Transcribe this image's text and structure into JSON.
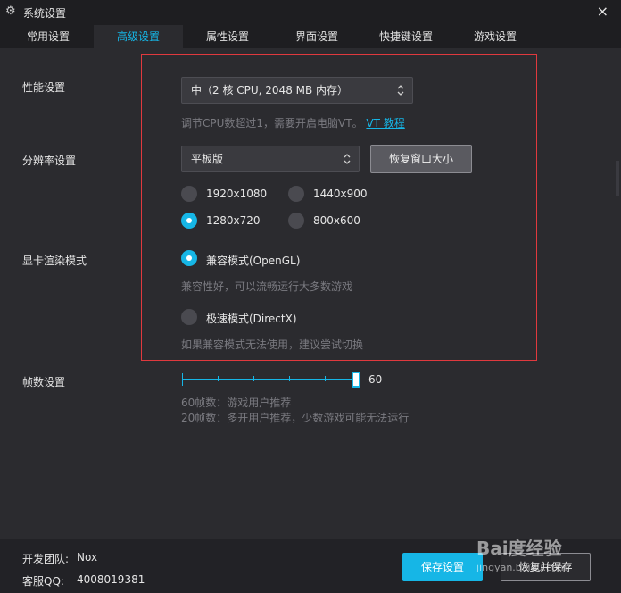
{
  "window": {
    "title": "系统设置",
    "gear_icon": "gear-icon",
    "close_icon": "close-icon",
    "close_glyph": "×"
  },
  "tabs": [
    {
      "label": "常用设置"
    },
    {
      "label": "高级设置",
      "active": true
    },
    {
      "label": "属性设置"
    },
    {
      "label": "界面设置"
    },
    {
      "label": "快捷键设置"
    },
    {
      "label": "游戏设置"
    }
  ],
  "performance": {
    "label": "性能设置",
    "select_value": "中（2 核 CPU, 2048 MB 内存）",
    "hint_prefix": "调节CPU数超过1，需要开启电脑VT。",
    "hint_link": "VT 教程"
  },
  "resolution": {
    "label": "分辨率设置",
    "select_value": "平板版",
    "restore_button": "恢复窗口大小",
    "options": [
      {
        "label": "1920x1080",
        "selected": false
      },
      {
        "label": "1440x900",
        "selected": false
      },
      {
        "label": "1280x720",
        "selected": true
      },
      {
        "label": "800x600",
        "selected": false
      }
    ]
  },
  "render": {
    "label": "显卡渲染模式",
    "option1": "兼容模式(OpenGL)",
    "option1_hint": "兼容性好，可以流畅运行大多数游戏",
    "option2": "极速模式(DirectX)",
    "option2_hint": "如果兼容模式无法使用，建议尝试切换",
    "selected": "option1"
  },
  "fps": {
    "label": "帧数设置",
    "value": "60",
    "hint1": "60帧数：游戏用户推荐",
    "hint2": "20帧数：多开用户推荐，少数游戏可能无法运行"
  },
  "footer": {
    "team_label": "开发团队:",
    "team_value": "Nox",
    "qq_label": "客服QQ:",
    "qq_value": "4008019381",
    "save_button": "保存设置",
    "restore_save_button": "恢复并保存"
  },
  "watermark": {
    "line1": "Bai度经验",
    "line2": "jingyan.baidu.com"
  },
  "colors": {
    "accent": "#16b6e6",
    "highlight_box": "#e0393e",
    "background": "#2b2b2f"
  }
}
